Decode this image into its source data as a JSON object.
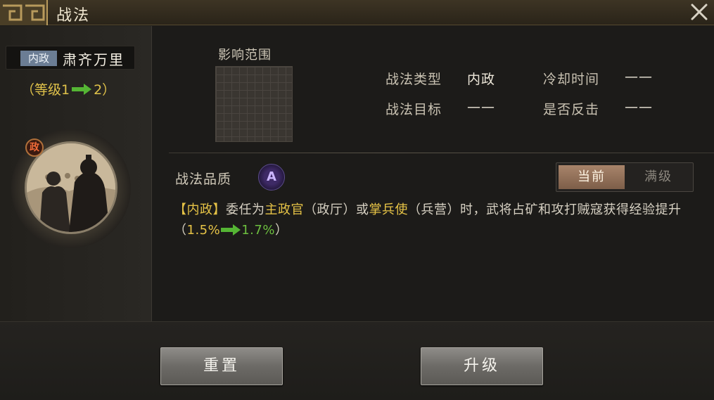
{
  "window": {
    "title": "战法"
  },
  "skill": {
    "type_tag": "内政",
    "name": "肃齐万里",
    "level_prefix": "（等级1",
    "level_suffix": "2）",
    "badge": "政"
  },
  "panel": {
    "effect_range_label": "影响范围",
    "info": {
      "type_label": "战法类型",
      "type_value": "内政",
      "cooldown_label": "冷却时间",
      "cooldown_value": "——",
      "target_label": "战法目标",
      "target_value": "——",
      "counter_label": "是否反击",
      "counter_value": "——"
    },
    "quality_label": "战法品质",
    "quality_value": "A",
    "toggle": {
      "current": "当前",
      "max": "满级"
    }
  },
  "description": {
    "tag": "【内政】",
    "part1": "委任为",
    "role1": "主政官",
    "part2": "（政厅）或",
    "role2": "掌兵使",
    "part3": "（兵营）时，武将占矿和攻打贼寇获得经验提升（",
    "value_from": "1.5%",
    "value_to": "1.7%",
    "part4": "）"
  },
  "buttons": {
    "reset": "重置",
    "upgrade": "升级"
  },
  "colors": {
    "accent_yellow": "#e6c346",
    "accent_green": "#6dbf3f",
    "quality_purple": "#5b4c8a"
  }
}
